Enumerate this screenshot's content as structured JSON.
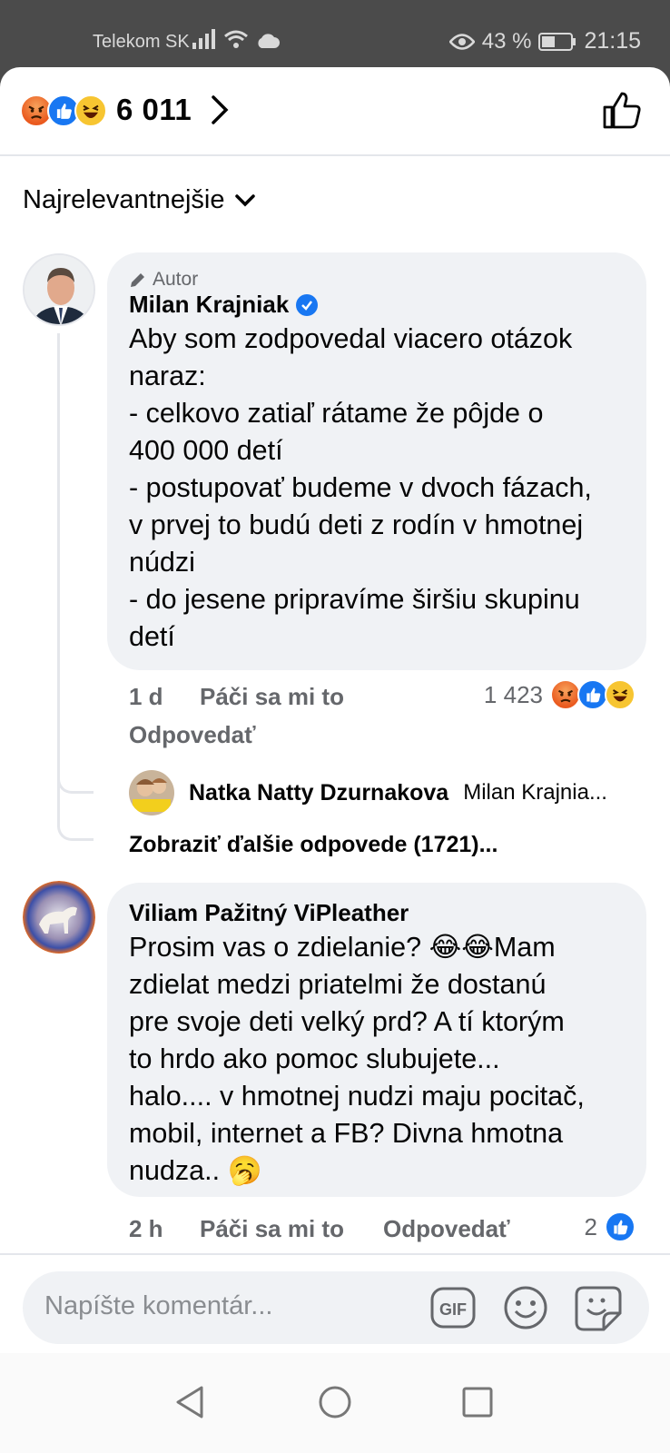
{
  "status_bar": {
    "carrier": "Telekom SK",
    "battery": "43 %",
    "time": "21:15"
  },
  "reactions_header": {
    "count": "6 011",
    "icons": [
      "angry-emoji",
      "like-emoji",
      "haha-emoji"
    ]
  },
  "sort": {
    "label": "Najrelevantnejšie"
  },
  "comments": [
    {
      "tag": "Autor",
      "name": "Milan Krajniak",
      "verified": true,
      "text": "Aby som zodpovedal viacero otázok\nnaraz:\n- celkovo zatiaľ rátame že pôjde o\n400 000 detí\n- postupovať budeme v dvoch fázach,\nv prvej to budú deti z rodín v hmotnej\nnúdzi\n- do jesene pripravíme širšiu skupinu\ndetí",
      "time": "1 d",
      "like_label": "Páči sa mi to",
      "reply_label": "Odpovedať",
      "reaction_count": "1 423"
    },
    {
      "name": "Viliam Pažitný ViPleather",
      "text": "Prosim vas o zdielanie? 😂😂Mam\nzdielat medzi priatelmi že dostanú\npre svoje deti velký prd? A tí ktorým\nto hrdo ako pomoc slubujete...\nhalo.... v hmotnej nudzi maju pocitač,\nmobil, internet a FB? Divna hmotna\nnudza.. 🥱",
      "time": "2 h",
      "like_label": "Páči sa mi to",
      "reply_label": "Odpovedať",
      "reaction_count": "2"
    }
  ],
  "reply_preview": {
    "name": "Natka Natty Dzurnakova",
    "text": "Milan Krajnia..."
  },
  "more_replies": "Zobraziť ďalšie odpovede (1721)...",
  "composer": {
    "placeholder": "Napíšte komentár...",
    "gif_label": "GIF"
  }
}
